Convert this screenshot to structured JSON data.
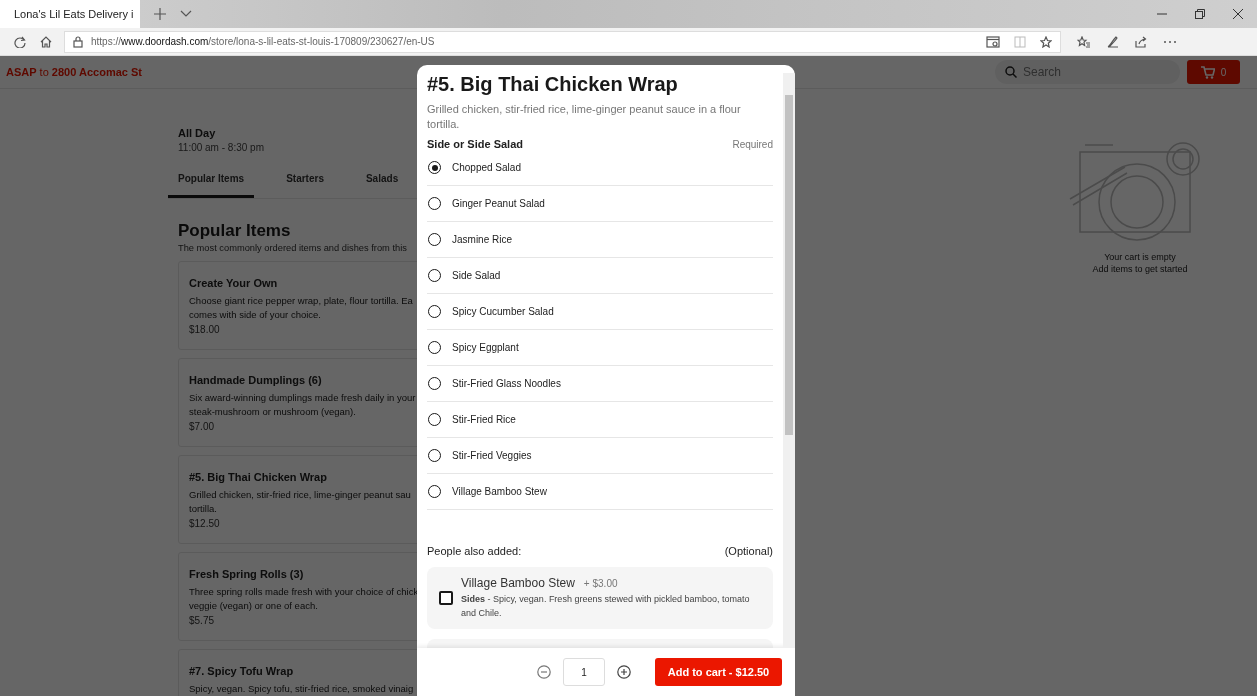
{
  "browser": {
    "tab": {
      "title": "Lona's Lil Eats Delivery i",
      "selected": true
    },
    "url": "https://**www.doordash.com**/store/lona-s-lil-eats-st-louis-170809/230627/en-US"
  },
  "header": {
    "delivery": "**ASAP** to **2800 Accomac St**",
    "search": {
      "placeholder": "Search"
    },
    "cart_count": "0"
  },
  "menu": {
    "hours_title": "All Day",
    "hours": "11:00 am - 8:30 pm",
    "tabs": [
      {
        "label": "Popular Items",
        "selected": true
      },
      {
        "label": "Starters",
        "selected": false
      },
      {
        "label": "Salads",
        "selected": false
      }
    ],
    "section_title": "Popular Items",
    "section_subtitle": "The most commonly ordered items and dishes from this",
    "items": [
      {
        "name": "Create Your Own",
        "description": "Choose giant rice pepper wrap, plate, flour tortilla. Ea\ncomes with side of your choice.",
        "price": "$18.00"
      },
      {
        "name": "Handmade Dumplings (6)",
        "description": "Six award-winning dumplings made fresh daily in your\nsteak-mushroom or mushroom (vegan).",
        "price": "$7.00"
      },
      {
        "name": "#5. Big Thai Chicken Wrap",
        "description": "Grilled chicken, stir-fried rice, lime-ginger peanut sau\ntortilla.",
        "price": "$12.50"
      },
      {
        "name": "Fresh Spring Rolls (3)",
        "description": "Three spring rolls made fresh with your choice of chick\nveggie (vegan) or one of each.",
        "price": "$5.75"
      },
      {
        "name": "#7. Spicy Tofu Wrap",
        "description": "Spicy, vegan. Spicy tofu, stir-fried rice, smoked vinaig"
      }
    ]
  },
  "cart": {
    "empty_title": "Your cart is empty",
    "empty_hint": "Add items to get started"
  },
  "modal": {
    "title": "#5. Big Thai Chicken Wrap",
    "description": "Grilled chicken, stir-fried rice, lime-ginger peanut sauce in a flour tortilla.",
    "option_group": {
      "title": "Side or Side Salad",
      "badge": "Required",
      "options": [
        {
          "label": "Chopped Salad",
          "selected": true
        },
        {
          "label": "Ginger Peanut Salad",
          "selected": false
        },
        {
          "label": "Jasmine Rice",
          "selected": false
        },
        {
          "label": "Side Salad",
          "selected": false
        },
        {
          "label": "Spicy Cucumber Salad",
          "selected": false
        },
        {
          "label": "Spicy Eggplant",
          "selected": false
        },
        {
          "label": "Stir-Fried Glass Noodles",
          "selected": false
        },
        {
          "label": "Stir-Fried Rice",
          "selected": false
        },
        {
          "label": "Stir-Fried Veggies",
          "selected": false
        },
        {
          "label": "Village Bamboo Stew",
          "selected": false
        }
      ]
    },
    "addons": {
      "title": "People also added:",
      "badge": "(Optional)",
      "items": [
        {
          "name": "Village Bamboo Stew",
          "price": "+ $3.00",
          "description": "**Sides** - Spicy, vegan. Fresh greens stewed with pickled bamboo, tomato and Chile.",
          "checked": false
        }
      ]
    },
    "quantity": "1",
    "add_button": "Add to cart - $12.50"
  }
}
